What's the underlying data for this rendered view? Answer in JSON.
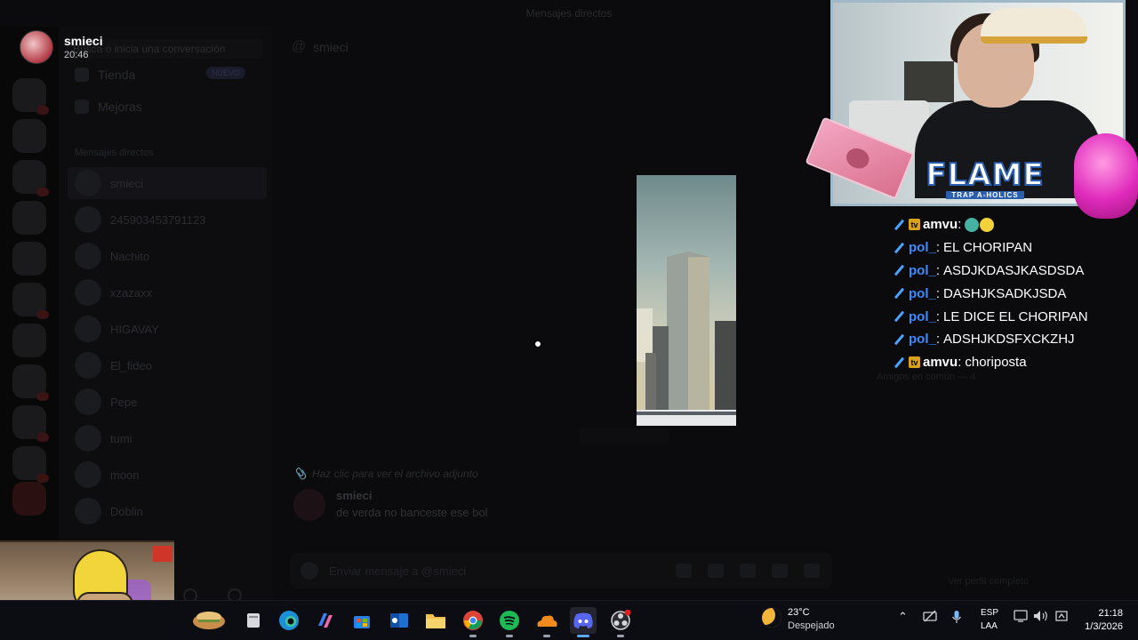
{
  "profile": {
    "name": "smieci",
    "time": "20:46"
  },
  "discord": {
    "window_title": "Mensajes directos",
    "search_placeholder": "Busca o inicia una conversación",
    "nav": [
      {
        "label": "Tienda",
        "badge": "NUEVO"
      },
      {
        "label": "Mejoras"
      }
    ],
    "dm_header": "Mensajes directos",
    "dm_list": [
      "smieci",
      "245903453791123",
      "Nachito",
      "xzazaxx",
      "HIGAVAY",
      "El_fideo",
      "Pepe",
      "tumi",
      "moon",
      "Doblin"
    ],
    "chat_title": "smieci",
    "system_message": "Haz clic para ver el archivo adjunto",
    "message_author": "smieci",
    "message_text": "de verda no banceste ese bol",
    "composer_placeholder": "Enviar mensaje a @smieci",
    "right_panel_label": "Amigos en común — 4",
    "right_footer": "Ver perfil completo"
  },
  "overlay": {
    "brand": "FLAME",
    "brand_sub": "TRAP A-HOLICS",
    "chat": [
      {
        "user": "amvu",
        "badge": "twitch",
        "text": "",
        "emotes": true
      },
      {
        "user": "pol_",
        "badge": "sword",
        "text": "EL CHORIPAN"
      },
      {
        "user": "pol_",
        "badge": "sword",
        "text": "ASDJKDASJKASDSDA"
      },
      {
        "user": "pol_",
        "badge": "sword",
        "text": "DASHJKSADKJSDA"
      },
      {
        "user": "pol_",
        "badge": "sword",
        "text": "LE DICE EL CHORIPAN"
      },
      {
        "user": "pol_",
        "badge": "sword",
        "text": "ADSHJKDSFXCKZHJ"
      },
      {
        "user": "amvu",
        "badge": "twitch",
        "text": "choriposta"
      }
    ]
  },
  "taskbar": {
    "apps": [
      "widgets-icon",
      "file-explorer-icon",
      "edge-icon",
      "copilot-icon",
      "store-icon",
      "outlook-icon",
      "folder-icon",
      "chrome-icon",
      "spotify-icon",
      "cloud-icon",
      "discord-icon",
      "obs-icon"
    ],
    "active_app": "discord-icon",
    "weather": {
      "temp": "23°C",
      "desc": "Despejado"
    },
    "lang_top": "ESP",
    "lang_bottom": "LAA",
    "time": "21:18",
    "date": "1/3/2026"
  },
  "colors": {
    "pol_name": "#3d8bff",
    "flame_outline": "#2b5fb0",
    "discord_active": "#5fa8ff"
  }
}
